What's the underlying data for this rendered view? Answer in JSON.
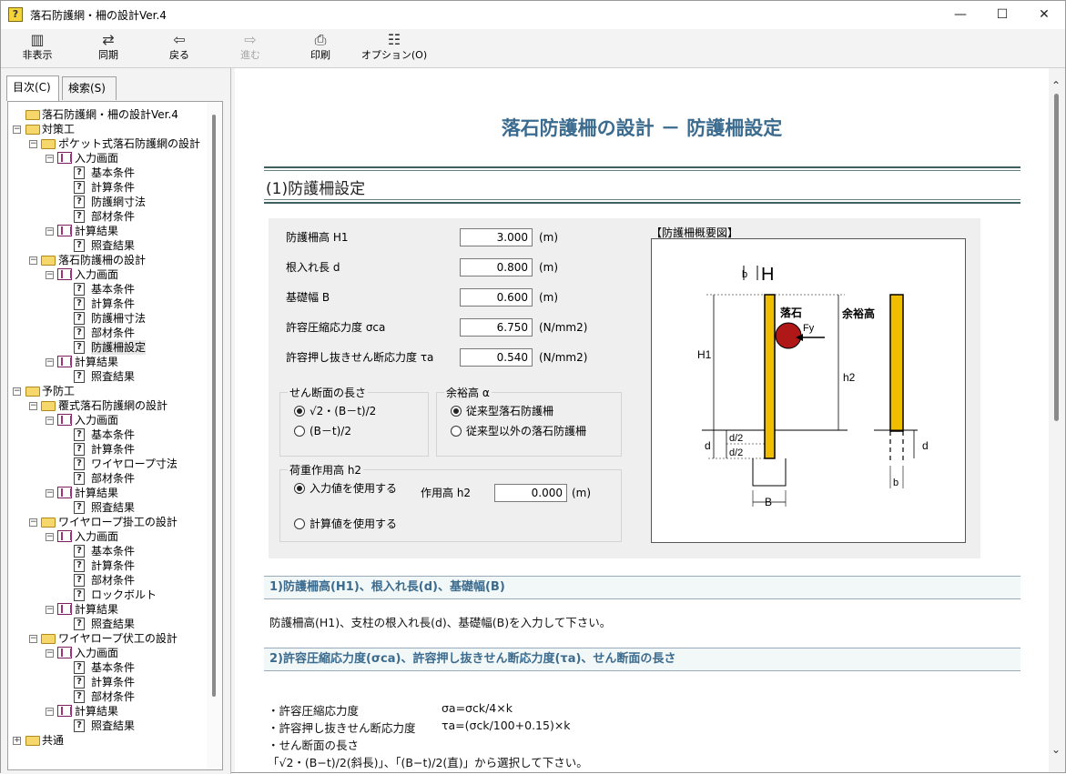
{
  "window": {
    "title": "落石防護網・柵の設計Ver.4",
    "controls": {
      "minimize": "—",
      "maximize": "☐",
      "close": "✕"
    }
  },
  "toolbar": {
    "items": [
      {
        "label": "非表示",
        "icon": "hide-icon",
        "glyph": "▥",
        "enabled": true
      },
      {
        "label": "同期",
        "icon": "sync-icon",
        "glyph": "⇄",
        "enabled": true
      },
      {
        "label": "戻る",
        "icon": "back-arrow-icon",
        "glyph": "⇦",
        "enabled": true
      },
      {
        "label": "進む",
        "icon": "forward-arrow-icon",
        "glyph": "⇨",
        "enabled": false
      },
      {
        "label": "印刷",
        "icon": "print-icon",
        "glyph": "⎙",
        "enabled": true
      },
      {
        "label": "オプション(O)",
        "icon": "options-icon",
        "glyph": "☷",
        "enabled": true
      }
    ]
  },
  "tabs": {
    "contents": "目次(C)",
    "search": "検索(S)"
  },
  "tree": [
    {
      "level": 0,
      "type": "folder",
      "label": "落石防護網・柵の設計Ver.4",
      "exp": ""
    },
    {
      "level": 0,
      "type": "folder",
      "label": "対策工",
      "exp": "−"
    },
    {
      "level": 1,
      "type": "folder",
      "label": "ポケット式落石防護網の設計",
      "exp": "−"
    },
    {
      "level": 2,
      "type": "book",
      "label": "入力画面",
      "exp": "−"
    },
    {
      "level": 3,
      "type": "page",
      "label": "基本条件",
      "exp": ""
    },
    {
      "level": 3,
      "type": "page",
      "label": "計算条件",
      "exp": ""
    },
    {
      "level": 3,
      "type": "page",
      "label": "防護網寸法",
      "exp": ""
    },
    {
      "level": 3,
      "type": "page",
      "label": "部材条件",
      "exp": ""
    },
    {
      "level": 2,
      "type": "book",
      "label": "計算結果",
      "exp": "−"
    },
    {
      "level": 3,
      "type": "page",
      "label": "照査結果",
      "exp": ""
    },
    {
      "level": 1,
      "type": "folder",
      "label": "落石防護柵の設計",
      "exp": "−"
    },
    {
      "level": 2,
      "type": "book",
      "label": "入力画面",
      "exp": "−"
    },
    {
      "level": 3,
      "type": "page",
      "label": "基本条件",
      "exp": ""
    },
    {
      "level": 3,
      "type": "page",
      "label": "計算条件",
      "exp": ""
    },
    {
      "level": 3,
      "type": "page",
      "label": "防護柵寸法",
      "exp": ""
    },
    {
      "level": 3,
      "type": "page",
      "label": "部材条件",
      "exp": ""
    },
    {
      "level": 3,
      "type": "page",
      "label": "防護柵設定",
      "exp": "",
      "selected": true
    },
    {
      "level": 2,
      "type": "book",
      "label": "計算結果",
      "exp": "−"
    },
    {
      "level": 3,
      "type": "page",
      "label": "照査結果",
      "exp": ""
    },
    {
      "level": 0,
      "type": "folder",
      "label": "予防工",
      "exp": "−"
    },
    {
      "level": 1,
      "type": "folder",
      "label": "覆式落石防護網の設計",
      "exp": "−"
    },
    {
      "level": 2,
      "type": "book",
      "label": "入力画面",
      "exp": "−"
    },
    {
      "level": 3,
      "type": "page",
      "label": "基本条件",
      "exp": ""
    },
    {
      "level": 3,
      "type": "page",
      "label": "計算条件",
      "exp": ""
    },
    {
      "level": 3,
      "type": "page",
      "label": "ワイヤロープ寸法",
      "exp": ""
    },
    {
      "level": 3,
      "type": "page",
      "label": "部材条件",
      "exp": ""
    },
    {
      "level": 2,
      "type": "book",
      "label": "計算結果",
      "exp": "−"
    },
    {
      "level": 3,
      "type": "page",
      "label": "照査結果",
      "exp": ""
    },
    {
      "level": 1,
      "type": "folder",
      "label": "ワイヤロープ掛工の設計",
      "exp": "−"
    },
    {
      "level": 2,
      "type": "book",
      "label": "入力画面",
      "exp": "−"
    },
    {
      "level": 3,
      "type": "page",
      "label": "基本条件",
      "exp": ""
    },
    {
      "level": 3,
      "type": "page",
      "label": "計算条件",
      "exp": ""
    },
    {
      "level": 3,
      "type": "page",
      "label": "部材条件",
      "exp": ""
    },
    {
      "level": 3,
      "type": "page",
      "label": "ロックボルト",
      "exp": ""
    },
    {
      "level": 2,
      "type": "book",
      "label": "計算結果",
      "exp": "−"
    },
    {
      "level": 3,
      "type": "page",
      "label": "照査結果",
      "exp": ""
    },
    {
      "level": 1,
      "type": "folder",
      "label": "ワイヤロープ伏工の設計",
      "exp": "−"
    },
    {
      "level": 2,
      "type": "book",
      "label": "入力画面",
      "exp": "−"
    },
    {
      "level": 3,
      "type": "page",
      "label": "基本条件",
      "exp": ""
    },
    {
      "level": 3,
      "type": "page",
      "label": "計算条件",
      "exp": ""
    },
    {
      "level": 3,
      "type": "page",
      "label": "部材条件",
      "exp": ""
    },
    {
      "level": 2,
      "type": "book",
      "label": "計算結果",
      "exp": "−"
    },
    {
      "level": 3,
      "type": "page",
      "label": "照査結果",
      "exp": ""
    },
    {
      "level": 0,
      "type": "folder",
      "label": "共通",
      "exp": "+"
    }
  ],
  "doc": {
    "title": "落石防護柵の設計 － 防護柵設定",
    "section": "(1)防護柵設定",
    "form": {
      "fields": [
        {
          "label": "防護柵高 H1",
          "value": "3.000",
          "unit": "(m)"
        },
        {
          "label": "根入れ長 d",
          "value": "0.800",
          "unit": "(m)"
        },
        {
          "label": "基礎幅 B",
          "value": "0.600",
          "unit": "(m)"
        },
        {
          "label": "許容圧縮応力度 σca",
          "value": "6.750",
          "unit": "(N/mm2)"
        },
        {
          "label": "許容押し抜きせん断応力度 τa",
          "value": "0.540",
          "unit": "(N/mm2)"
        }
      ],
      "shear_group": {
        "label": "せん断面の長さ",
        "options": [
          {
            "label": "√2・(B－t)/2",
            "checked": true
          },
          {
            "label": "(B－t)/2",
            "checked": false
          }
        ]
      },
      "margin_group": {
        "label": "余裕高 α",
        "options": [
          {
            "label": "従来型落石防護柵",
            "checked": true
          },
          {
            "label": "従来型以外の落石防護柵",
            "checked": false
          }
        ]
      },
      "load_group": {
        "label": "荷重作用高 h2",
        "options": [
          {
            "label": "入力値を使用する",
            "checked": true
          },
          {
            "label": "計算値を使用する",
            "checked": false
          }
        ],
        "h2_label": "作用高 h2",
        "h2_value": "0.000",
        "h2_unit": "(m)"
      }
    },
    "diagram": {
      "title": "【防護柵概要図】",
      "labels": {
        "rock": "落石",
        "force": "Fy",
        "margin": "余裕高",
        "H1": "H1",
        "h2": "h2",
        "d": "d",
        "d2": "d/2",
        "B": "B",
        "b": "b",
        "H": "H",
        "legend_b": "b"
      },
      "colors": {
        "post": "#f0be00",
        "rock": "#b01818"
      }
    },
    "sub1": {
      "head": "1)防護柵高(H1)、根入れ長(d)、基礎幅(B)",
      "text": "防護柵高(H1)、支柱の根入れ長(d)、基礎幅(B)を入力して下さい。"
    },
    "sub2": {
      "head": "2)許容圧縮応力度(σca)、許容押し抜きせん断応力度(τa)、せん断面の長さ",
      "lines": [
        {
          "item": "・許容圧縮応力度",
          "formula": "σa=σck/4×k"
        },
        {
          "item": "・許容押し抜きせん断応力度",
          "formula": "τa=(σck/100+0.15)×k"
        },
        {
          "item": "・せん断面の長さ",
          "formula": ""
        }
      ],
      "note": "「√2・(B−t)/2(斜長)」、「(B−t)/2(直)」から選択して下さい。"
    }
  }
}
